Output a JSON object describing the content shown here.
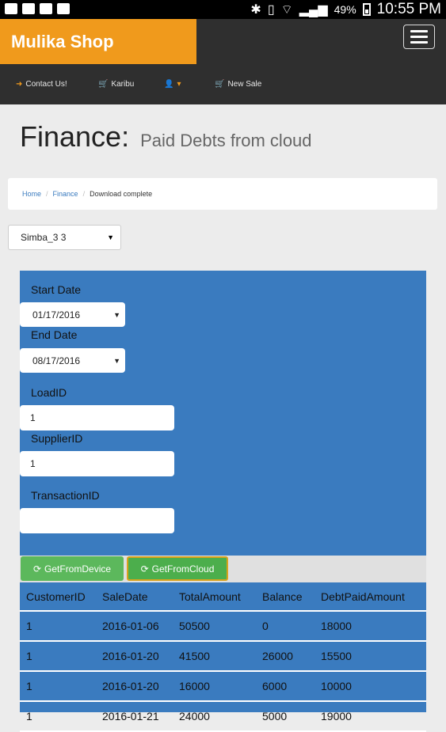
{
  "status_bar": {
    "battery": "49%",
    "time": "10:55 PM",
    "icons_left": [
      "excel-icon",
      "image-icon",
      "mail-icon",
      "bag-icon"
    ],
    "icons_right": [
      "bluetooth-icon",
      "vibrate-icon",
      "wifi-icon",
      "signal-icon",
      "battery-icon"
    ]
  },
  "header": {
    "brand": "Mulika Shop",
    "nav": [
      {
        "label": "Contact Us!",
        "icon": "sign-in-icon"
      },
      {
        "label": "Karibu",
        "icon": "cart-icon"
      },
      {
        "label": "",
        "icon": "user-icon"
      },
      {
        "label": "New Sale",
        "icon": "cart-icon"
      }
    ]
  },
  "page": {
    "title": "Finance:",
    "subtitle": "Paid Debts from cloud"
  },
  "breadcrumb": {
    "home": "Home",
    "finance": "Finance",
    "current": "Download complete"
  },
  "store_select": {
    "value": "Simba_3 3"
  },
  "form": {
    "start_date_label": "Start Date",
    "start_date": "01/17/2016",
    "end_date_label": "End Date",
    "end_date": "08/17/2016",
    "load_id_label": "LoadID",
    "load_id": "1",
    "supplier_id_label": "SupplierID",
    "supplier_id": "1",
    "transaction_id_label": "TransactionID",
    "transaction_id": ""
  },
  "buttons": {
    "get_from_device": "GetFromDevice",
    "get_from_cloud": "GetFromCloud"
  },
  "table": {
    "columns": [
      "CustomerID",
      "SaleDate",
      "TotalAmount",
      "Balance",
      "DebtPaidAmount"
    ],
    "rows": [
      [
        "1",
        "2016-01-06",
        "50500",
        "0",
        "18000"
      ],
      [
        "1",
        "2016-01-20",
        "41500",
        "26000",
        "15500"
      ],
      [
        "1",
        "2016-01-20",
        "16000",
        "6000",
        "10000"
      ],
      [
        "1",
        "2016-01-21",
        "24000",
        "5000",
        "19000"
      ]
    ]
  },
  "colors": {
    "brand": "#f09a1c",
    "header_bg": "#2f2f2f",
    "panel": "#3a7bbf",
    "button_green": "#5cb85c"
  }
}
